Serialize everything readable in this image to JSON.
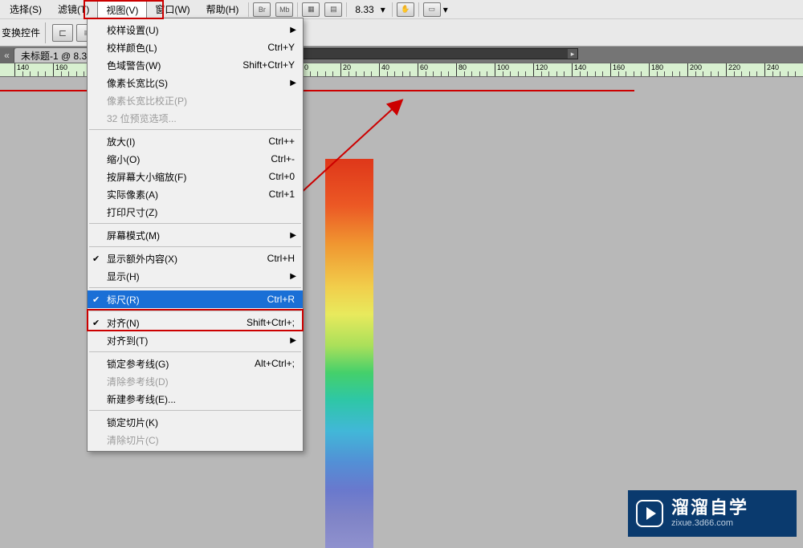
{
  "menubar": {
    "items": [
      {
        "label": "选择(S)"
      },
      {
        "label": "滤镜(T)"
      },
      {
        "label": "视图(V)"
      },
      {
        "label": "窗口(W)"
      },
      {
        "label": "帮助(H)"
      }
    ],
    "icon_labels": [
      "Br",
      "Mb",
      "▦",
      "▤"
    ],
    "zoom": "8.33",
    "zoom_arrow": "▾"
  },
  "toolbar": {
    "label": "变换控件"
  },
  "tab": {
    "close": "«",
    "title": "未标题-1 @ 8.3"
  },
  "ruler": {
    "ticks": [
      "140",
      "160",
      "180",
      "200",
      "220",
      "240",
      "0",
      "20",
      "40",
      "60",
      "80",
      "100",
      "120",
      "140",
      "160",
      "180",
      "200",
      "220",
      "240"
    ]
  },
  "dropdown": {
    "groups": [
      [
        {
          "label": "校样设置(U)",
          "sub": true
        },
        {
          "label": "校样颜色(L)",
          "shortcut": "Ctrl+Y"
        },
        {
          "label": "色域警告(W)",
          "shortcut": "Shift+Ctrl+Y"
        },
        {
          "label": "像素长宽比(S)",
          "sub": true
        },
        {
          "label": "像素长宽比校正(P)",
          "disabled": true
        },
        {
          "label": "32 位预览选项...",
          "disabled": true
        }
      ],
      [
        {
          "label": "放大(I)",
          "shortcut": "Ctrl++"
        },
        {
          "label": "缩小(O)",
          "shortcut": "Ctrl+-"
        },
        {
          "label": "按屏幕大小缩放(F)",
          "shortcut": "Ctrl+0"
        },
        {
          "label": "实际像素(A)",
          "shortcut": "Ctrl+1"
        },
        {
          "label": "打印尺寸(Z)"
        }
      ],
      [
        {
          "label": "屏幕模式(M)",
          "sub": true
        }
      ],
      [
        {
          "label": "显示额外内容(X)",
          "shortcut": "Ctrl+H",
          "check": true
        },
        {
          "label": "显示(H)",
          "sub": true
        }
      ],
      [
        {
          "label": "标尺(R)",
          "shortcut": "Ctrl+R",
          "check": true,
          "selected": true
        }
      ],
      [
        {
          "label": "对齐(N)",
          "shortcut": "Shift+Ctrl+;",
          "check": true
        },
        {
          "label": "对齐到(T)",
          "sub": true
        }
      ],
      [
        {
          "label": "锁定参考线(G)",
          "shortcut": "Alt+Ctrl+;"
        },
        {
          "label": "清除参考线(D)",
          "disabled": true
        },
        {
          "label": "新建参考线(E)..."
        }
      ],
      [
        {
          "label": "锁定切片(K)"
        },
        {
          "label": "清除切片(C)",
          "disabled": true
        }
      ]
    ]
  },
  "watermark": {
    "title": "溜溜自学",
    "url": "zixue.3d66.com"
  }
}
